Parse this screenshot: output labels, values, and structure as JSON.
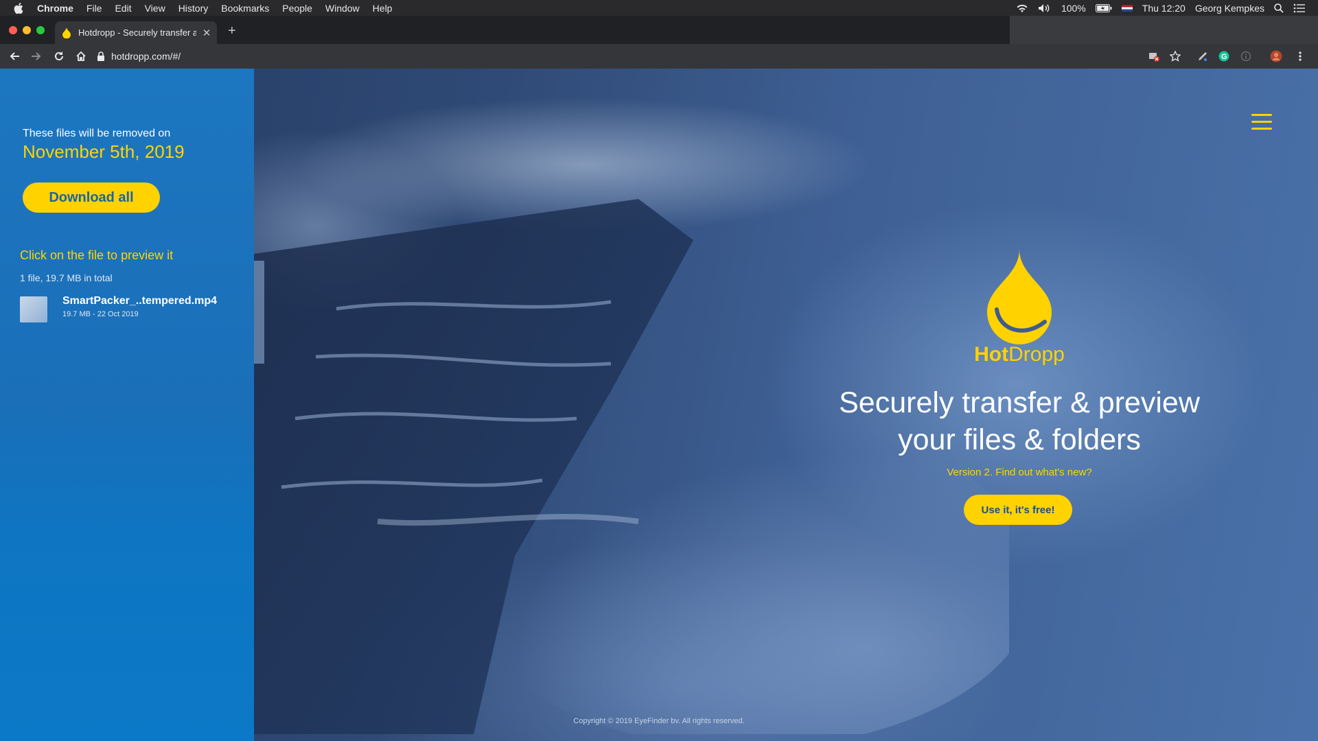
{
  "menubar": {
    "app_name": "Chrome",
    "menus": [
      "File",
      "Edit",
      "View",
      "History",
      "Bookmarks",
      "People",
      "Window",
      "Help"
    ],
    "battery": "100%",
    "clock": "Thu 12:20",
    "user": "Georg Kempkes",
    "icons": [
      "apple-icon",
      "wifi-icon",
      "volume-icon",
      "battery-icon",
      "flag-nl-icon",
      "spotlight-icon",
      "notification-center-icon"
    ]
  },
  "browser": {
    "tab_title": "Hotdropp - Securely transfer a",
    "url": "hotdropp.com/#/",
    "toolbar_icons": [
      "back-icon",
      "forward-icon",
      "reload-icon",
      "home-icon",
      "lock-icon",
      "blocked-icon",
      "star-icon",
      "pen-icon",
      "grammarly-icon",
      "info-icon",
      "profile-icon",
      "menu-icon"
    ]
  },
  "sidebar": {
    "removed_label": "These files will be removed on",
    "removed_date": "November 5th, 2019",
    "download_all": "Download all",
    "click_hint": "Click on the file to preview it",
    "file_count": "1 file, 19.7 MB in total",
    "files": [
      {
        "name": "SmartPacker_..tempered.mp4",
        "meta": "19.7 MB - 22 Oct 2019"
      }
    ]
  },
  "hero": {
    "brand_hot": "Hot",
    "brand_dropp": "Dropp",
    "headline_line1": "Securely transfer & preview",
    "headline_line2": "your files & folders",
    "version_link": "Version 2. Find out what's new?",
    "cta": "Use it, it's free!",
    "copyright": "Copyright © 2019 EyeFinder bv. All rights reserved."
  },
  "colors": {
    "accent_yellow": "#ffd200",
    "sidebar_blue": "#1a6fb8",
    "hero_blue": "#3e5f93"
  }
}
